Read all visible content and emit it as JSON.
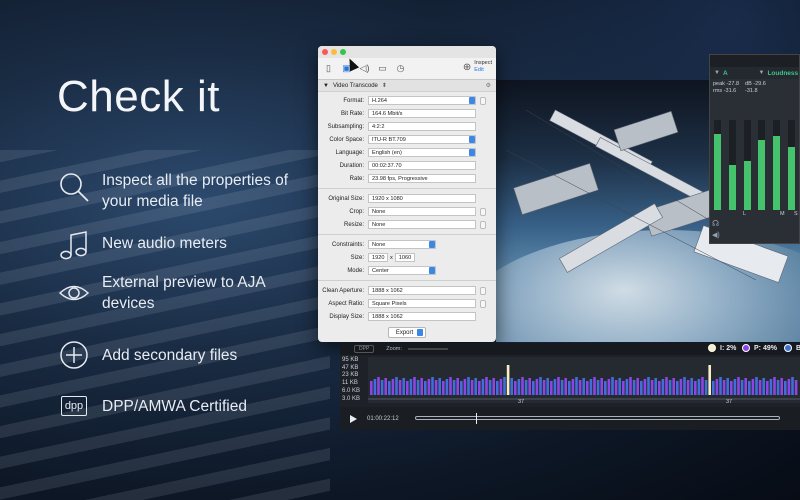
{
  "hero": {
    "heading": "Check it",
    "features": [
      {
        "icon": "magnifier-icon",
        "text": "Inspect all the properties of your media file"
      },
      {
        "icon": "music-note-icon",
        "text": "New audio meters"
      },
      {
        "icon": "eye-icon",
        "text": "External preview to AJA devices"
      },
      {
        "icon": "plus-circle-icon",
        "text": "Add secondary files"
      },
      {
        "icon": "dpp-icon",
        "text": "DPP/AMWA Certified",
        "badge": "dpp"
      }
    ]
  },
  "inspector": {
    "toolbar": {
      "icons": [
        "document-icon",
        "video-icon",
        "audio-icon",
        "display-icon",
        "clock-icon"
      ],
      "inspect_label": "Inspect",
      "edit_label": "Edit"
    },
    "section": "Video Transcode",
    "fields": [
      {
        "label": "Format:",
        "value": "H.264",
        "type": "select"
      },
      {
        "label": "Bit Rate:",
        "value": "164.6 Mbit/s",
        "type": "text"
      },
      {
        "label": "Subsampling:",
        "value": "4:2:2",
        "type": "text"
      },
      {
        "label": "Color Space:",
        "value": "ITU-R BT.709",
        "type": "select"
      },
      {
        "label": "Language:",
        "value": "English (en)",
        "type": "select"
      },
      {
        "label": "Duration:",
        "value": "00:02:37.70",
        "type": "text"
      },
      {
        "label": "Rate:",
        "value": "23.98 fps, Progressive",
        "type": "text"
      }
    ],
    "size_fields": [
      {
        "label": "Original Size:",
        "value": "1920 x 1080"
      },
      {
        "label": "Crop:",
        "value": "None"
      },
      {
        "label": "Resize:",
        "value": "None"
      }
    ],
    "constraints": {
      "label": "Constraints:",
      "value": "None"
    },
    "size": {
      "label": "Size:",
      "width": "1920",
      "x": "x",
      "height": "1060"
    },
    "mode": {
      "label": "Mode:",
      "value": "Center"
    },
    "aperture_fields": [
      {
        "label": "Clean Aperture:",
        "value": "1888 x 1062"
      },
      {
        "label": "Aspect Ratio:",
        "value": "Square Pixels"
      },
      {
        "label": "Display Size:",
        "value": "1888 x 1062"
      }
    ],
    "export_label": "Export"
  },
  "meters": {
    "tabs": [
      {
        "name": "A"
      },
      {
        "name": "Loudness"
      }
    ],
    "readouts_left": [
      "peak",
      "rms"
    ],
    "readouts_left_values": [
      "-27.8",
      "-31.6"
    ],
    "readouts_right_label": "dB",
    "readouts_right_values": [
      "-29.6",
      "-31.8"
    ],
    "channels": [
      "L",
      "M",
      "S"
    ],
    "levels": [
      0.85,
      0.5,
      0.55,
      0.78,
      0.82,
      0.7
    ]
  },
  "analyzer": {
    "zoom_label": "Zoom:",
    "dpp_chip": "DPP",
    "legend": [
      {
        "label": "I: 2%",
        "color": "#f6eec6"
      },
      {
        "label": "P: 49%",
        "color": "#8f45e6"
      },
      {
        "label": "B",
        "color": "#3e71d8"
      }
    ],
    "y_ticks": [
      "95 KB",
      "47 KB",
      "23 KB",
      "11 KB",
      "6.0 KB",
      "3.0 KB"
    ],
    "markers": [
      "37",
      "37"
    ],
    "timecode": "01:00:22:12"
  }
}
